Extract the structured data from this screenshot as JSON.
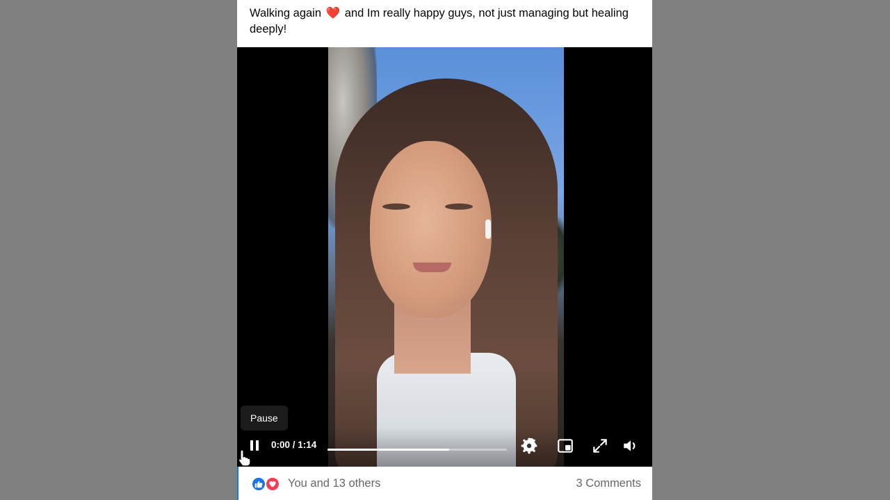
{
  "post": {
    "text_before_emoji": "Walking again",
    "emoji": "❤️",
    "text_after_emoji": "and Im really happy guys, not just managing but healing deeply!"
  },
  "video": {
    "tooltip": "Pause",
    "current_time": "0:00",
    "duration": "1:14",
    "time_display": "0:00 / 1:14",
    "progress_fraction": 0.68,
    "controls": {
      "pause_icon": "pause-icon",
      "settings_icon": "gear-icon",
      "pip_icon": "picture-in-picture-icon",
      "fullscreen_icon": "fullscreen-icon",
      "volume_icon": "volume-icon"
    }
  },
  "footer": {
    "reaction_icons": [
      "like-icon",
      "love-icon"
    ],
    "reactions_text": "You and 13 others",
    "comments_text": "3 Comments"
  },
  "colors": {
    "background": "#808080",
    "like_blue": "#1b74e4",
    "love_red": "#f33e58",
    "muted_text": "#65676b"
  }
}
